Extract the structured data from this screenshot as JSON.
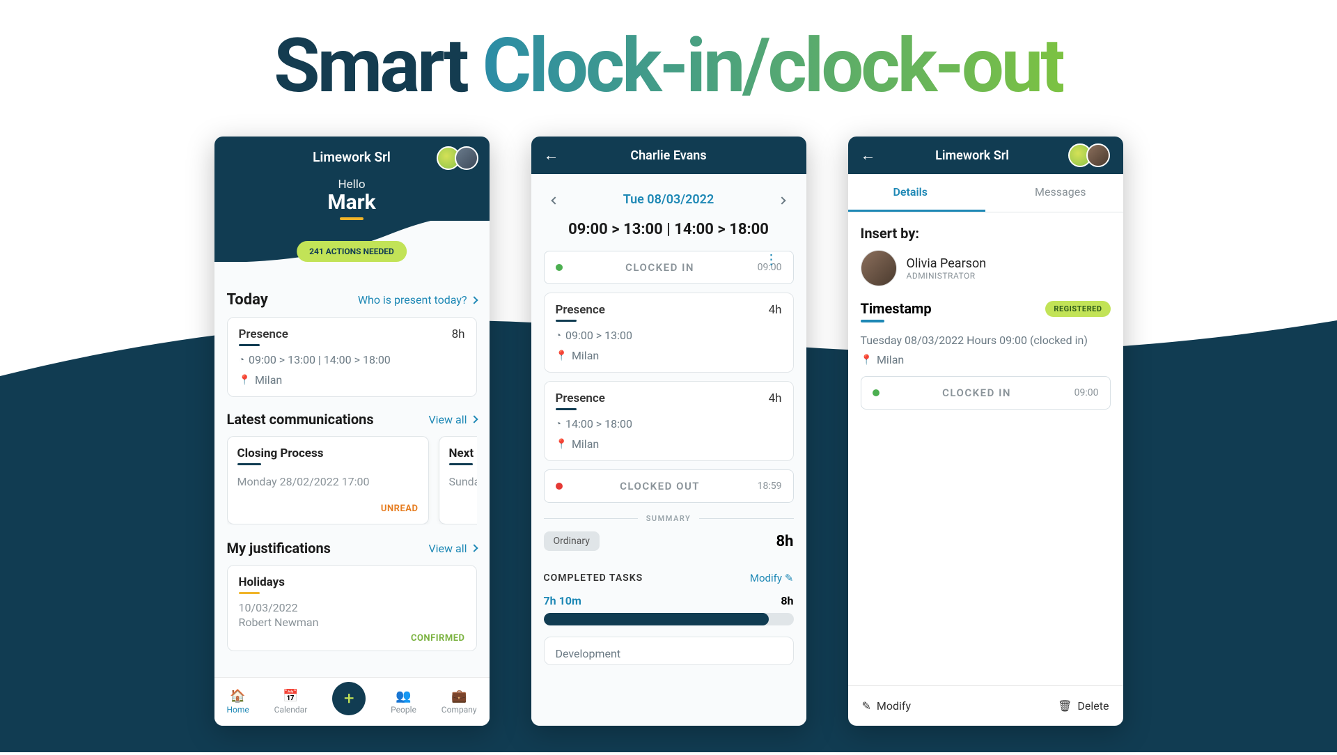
{
  "title": {
    "prefix": "Smart ",
    "suffix": "Clock-in/clock-out"
  },
  "phone1": {
    "company": "Limework Srl",
    "greeting": "Hello",
    "user": "Mark",
    "actions_badge": "241 ACTIONS NEEDED",
    "today_label": "Today",
    "present_link": "Who is present today?",
    "presence": {
      "label": "Presence",
      "hours": "8h",
      "times": "09:00 > 13:00  |  14:00 > 18:00",
      "city": "Milan"
    },
    "comm_label": "Latest communications",
    "view_all": "View all",
    "comm1": {
      "title": "Closing Process",
      "date": "Monday 28/02/2022 17:00",
      "status": "UNREAD"
    },
    "comm2": {
      "title": "Next is",
      "date": "Sunda"
    },
    "just_label": "My justifications",
    "just1": {
      "title": "Holidays",
      "date": "10/03/2022",
      "owner": "Robert Newman",
      "status": "CONFIRMED"
    },
    "nav": {
      "home": "Home",
      "calendar": "Calendar",
      "people": "People",
      "company": "Company"
    }
  },
  "phone2": {
    "name": "Charlie Evans",
    "date": "Tue 08/03/2022",
    "times": "09:00 > 13:00 | 14:00 > 18:00",
    "clockin_label": "CLOCKED IN",
    "clockin_time": "09:00",
    "pres1": {
      "label": "Presence",
      "hours": "4h",
      "times": "09:00 > 13:00",
      "city": "Milan"
    },
    "pres2": {
      "label": "Presence",
      "hours": "4h",
      "times": "14:00 > 18:00",
      "city": "Milan"
    },
    "clockout_label": "CLOCKED OUT",
    "clockout_time": "18:59",
    "summary": "SUMMARY",
    "ordinary": "Ordinary",
    "ordinary_val": "8h",
    "tasks_label": "COMPLETED TASKS",
    "modify": "Modify",
    "prog_done": "7h 10m",
    "prog_total": "8h",
    "dev_label": "Development"
  },
  "phone3": {
    "company": "Limework Srl",
    "tabs": {
      "details": "Details",
      "messages": "Messages"
    },
    "insert_label": "Insert by:",
    "inserter": {
      "name": "Olivia Pearson",
      "role": "ADMINISTRATOR"
    },
    "ts_label": "Timestamp",
    "ts_badge": "REGISTERED",
    "ts_text": "Tuesday 08/03/2022 Hours 09:00 (clocked in)",
    "city": "Milan",
    "clockin_label": "CLOCKED IN",
    "clockin_time": "09:00",
    "modify": "Modify",
    "delete": "Delete"
  }
}
